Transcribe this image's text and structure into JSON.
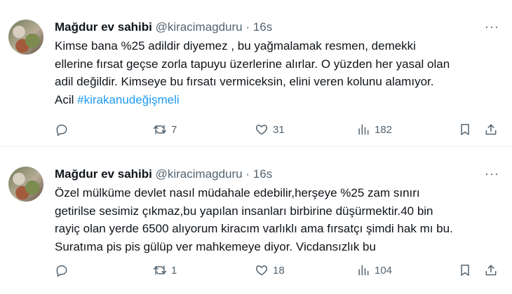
{
  "tweets": [
    {
      "name": "Mağdur ev sahibi",
      "handle": "@kiracimagduru",
      "separator": "·",
      "time": "16s",
      "more": "···",
      "text_lines": [
        "Kimse bana %25 adildir diyemez , bu yağmalamak resmen, demekki",
        "ellerine fırsat geçse zorla tapuyu üzerlerine alırlar. O yüzden her yasal olan",
        "adil değildir. Kimseye bu fırsatı vermiceksin, elini veren kolunu alamıyor."
      ],
      "last_line_prefix": "Acil ",
      "hashtag": "#kirakanudeğişmeli",
      "retweets": "7",
      "likes": "31",
      "views": "182"
    },
    {
      "name": "Mağdur ev sahibi",
      "handle": "@kiracimagduru",
      "separator": "·",
      "time": "16s",
      "more": "···",
      "text_lines": [
        "Özel mülküme devlet nasıl müdahale edebilir,herşeye %25 zam sınırı",
        "getirilse sesimiz çıkmaz,bu yapılan insanları birbirine düşürmektir.40 bin",
        "rayiç olan yerde 6500 alıyorum kiracım varlıklı ama fırsatçı şimdi hak mı bu.",
        "Suratıma pis pis gülüp ver mahkemeye diyor. Vicdansızlık bu"
      ],
      "last_line_prefix": "",
      "hashtag": "",
      "retweets": "1",
      "likes": "18",
      "views": "104"
    }
  ],
  "colors": {
    "text": "#0f1419",
    "muted": "#536471",
    "link": "#1d9bf0",
    "divider": "#eff3f4"
  },
  "icons": [
    "reply-icon",
    "retweet-icon",
    "like-icon",
    "views-icon",
    "bookmark-icon",
    "share-icon",
    "more-icon"
  ]
}
